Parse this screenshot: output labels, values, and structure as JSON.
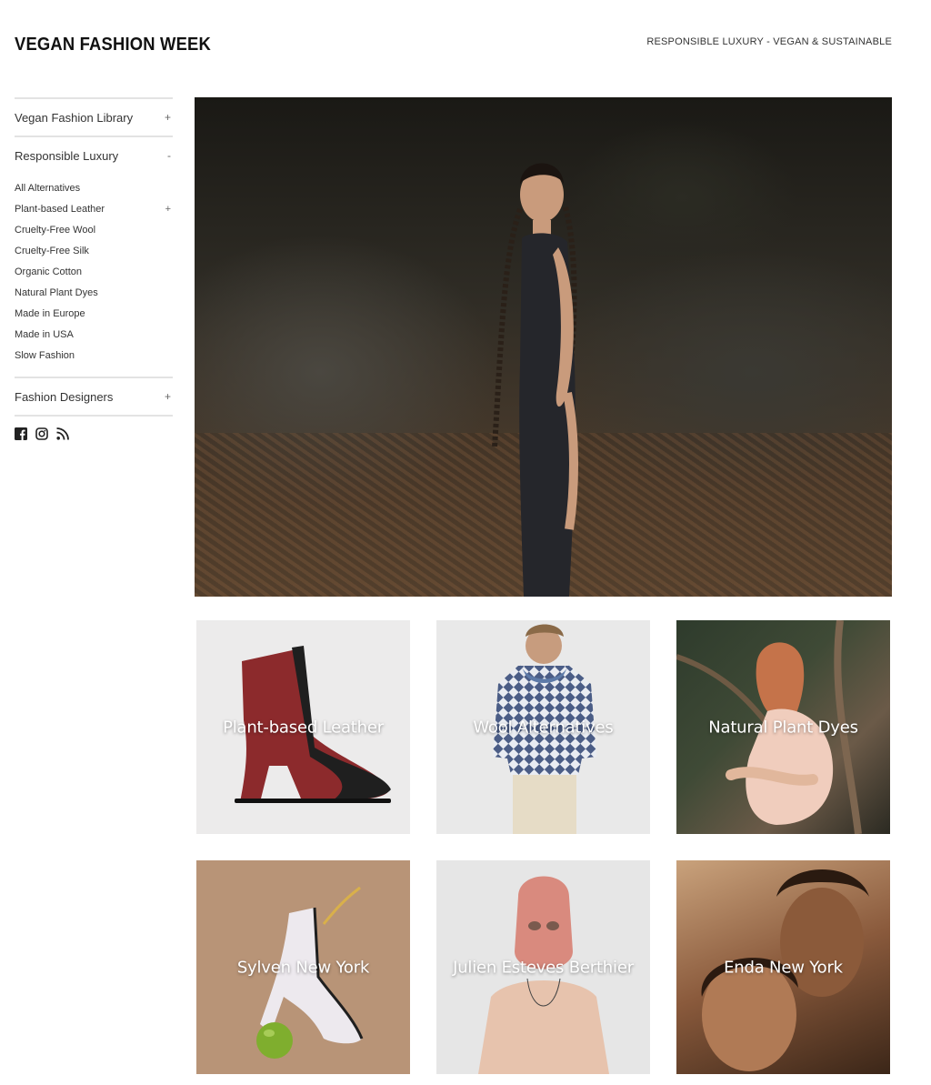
{
  "header": {
    "logo": "VEGAN FASHION WEEK",
    "tagline": "RESPONSIBLE LUXURY - VEGAN & SUSTAINABLE"
  },
  "sidebar": {
    "sections": [
      {
        "label": "Vegan Fashion Library",
        "toggle": "+"
      },
      {
        "label": "Responsible Luxury",
        "toggle": "-"
      },
      {
        "label": "Fashion Designers",
        "toggle": "+"
      }
    ],
    "sub_items": [
      {
        "label": "All Alternatives",
        "toggle": ""
      },
      {
        "label": "Plant-based Leather",
        "toggle": "+"
      },
      {
        "label": "Cruelty-Free Wool",
        "toggle": ""
      },
      {
        "label": "Cruelty-Free Silk",
        "toggle": ""
      },
      {
        "label": "Organic Cotton",
        "toggle": ""
      },
      {
        "label": "Natural Plant Dyes",
        "toggle": ""
      },
      {
        "label": "Made in Europe",
        "toggle": ""
      },
      {
        "label": "Made in USA",
        "toggle": ""
      },
      {
        "label": "Slow Fashion",
        "toggle": ""
      }
    ],
    "social_icons": [
      "facebook-icon",
      "instagram-icon",
      "rss-icon"
    ]
  },
  "tiles": [
    {
      "label": "Plant-based Leather"
    },
    {
      "label": "Wool Alternatives"
    },
    {
      "label": "Natural Plant Dyes"
    },
    {
      "label": "Sylven New York"
    },
    {
      "label": "Julien Esteves Berthier"
    },
    {
      "label": "Enda New York"
    }
  ]
}
